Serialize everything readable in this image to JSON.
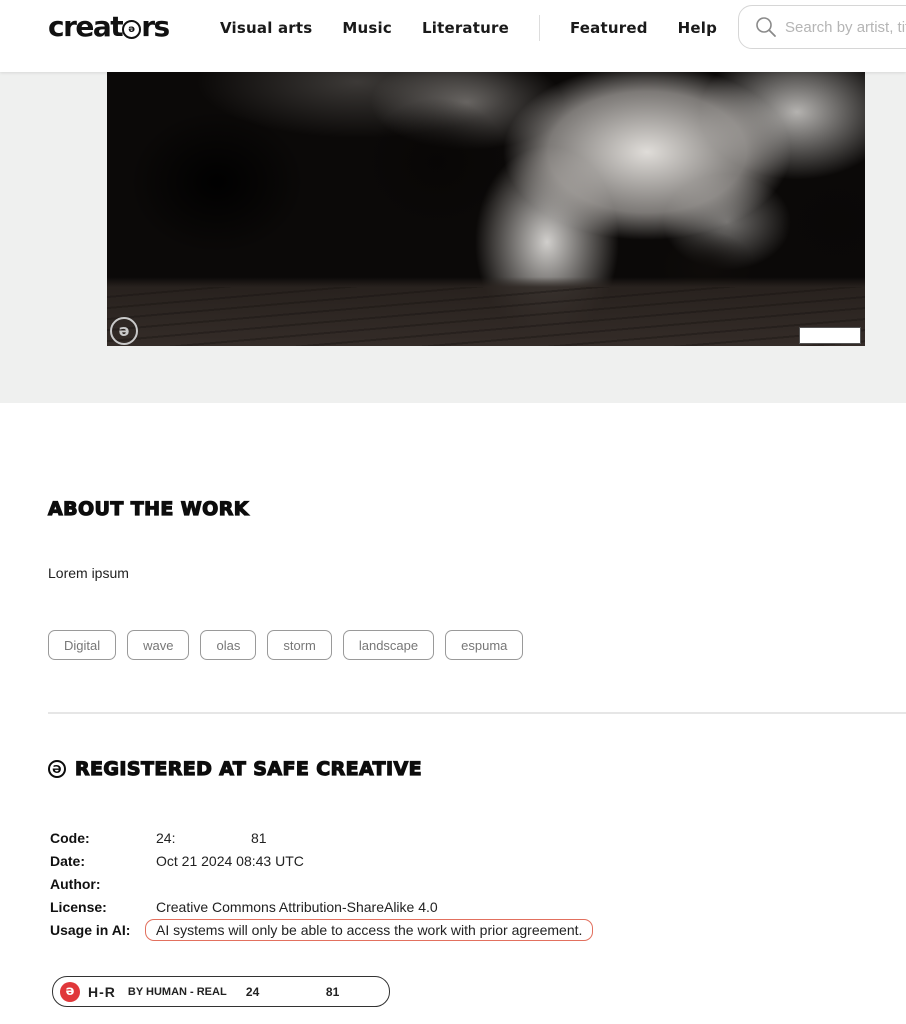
{
  "header": {
    "logo_text_pre": "creat",
    "logo_text_post": "rs",
    "logo_glyph": "ə",
    "nav": [
      {
        "label": "Visual arts"
      },
      {
        "label": "Music"
      },
      {
        "label": "Literature"
      },
      {
        "label": "Featured"
      },
      {
        "label": "Help"
      }
    ],
    "search": {
      "icon": "search-icon",
      "placeholder": "Search by artist, title...",
      "value": ""
    }
  },
  "hero": {
    "artwork_description": "Black and white photo of a wave crashing on dark rocks over sand",
    "badge_glyph": "ə",
    "badge_icon": "safe-creative-icon"
  },
  "about": {
    "title": "About the work",
    "description": "Lorem ipsum",
    "tags": [
      "Digital",
      "wave",
      "olas",
      "storm",
      "landscape",
      "espuma"
    ]
  },
  "registration": {
    "title": "Registered at Safe Creative",
    "icon_glyph": "ə",
    "rows": {
      "code": {
        "label": "Code:",
        "value_start": "24:",
        "value_end": "81"
      },
      "date": {
        "label": "Date:",
        "value": "Oct 21 2024 08:43 UTC"
      },
      "author": {
        "label": "Author:",
        "value": ""
      },
      "license": {
        "label": "License:",
        "value": "Creative Commons Attribution-ShareAlike 4.0"
      },
      "ai_usage": {
        "label": "Usage in AI:",
        "value": "AI systems will only be able to access the work with prior agreement."
      }
    },
    "badge": {
      "icon_glyph": "ə",
      "code": "H-R",
      "text": "BY HUMAN - REAL",
      "num_start": "24",
      "num_end": "81",
      "accent_color": "#e0373a"
    }
  },
  "colors": {
    "hero_bg": "#eff0ef",
    "ai_pill_border": "#e2705e"
  }
}
